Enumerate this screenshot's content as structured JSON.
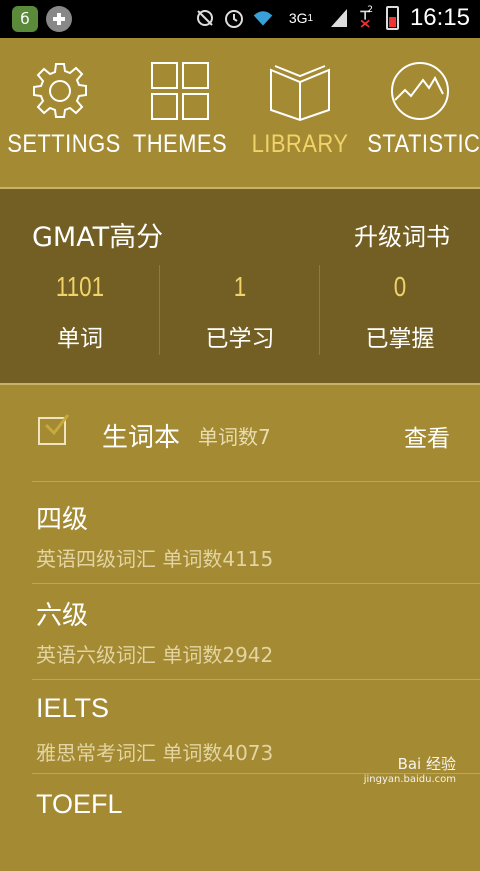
{
  "status_bar": {
    "time": "16:15",
    "network": "3G",
    "sim1": "1",
    "sim2": "2",
    "icons": [
      "app-icon",
      "add-icon",
      "sync-icon",
      "alarm-icon",
      "wifi-icon",
      "signal-icon",
      "battery-icon"
    ]
  },
  "nav": {
    "items": [
      {
        "label": "SETTINGS",
        "icon": "gear-icon"
      },
      {
        "label": "THEMES",
        "icon": "grid-icon"
      },
      {
        "label": "LIBRARY",
        "icon": "book-icon",
        "active": true
      },
      {
        "label": "STATISTICS",
        "icon": "chart-icon"
      }
    ]
  },
  "book": {
    "title": "GMAT高分",
    "upgrade_label": "升级词书",
    "stats": [
      {
        "value": "1101",
        "label": "单词"
      },
      {
        "value": "1",
        "label": "已学习"
      },
      {
        "value": "0",
        "label": "已掌握"
      }
    ]
  },
  "vocab_book": {
    "title": "生词本",
    "count": "单词数7",
    "view_label": "查看",
    "checked": true
  },
  "list": [
    {
      "title": "四级",
      "subtitle": "英语四级词汇  单词数4115"
    },
    {
      "title": "六级",
      "subtitle": "英语六级词汇  单词数2942"
    },
    {
      "title": "IELTS",
      "subtitle": "雅思常考词汇  单词数4073"
    },
    {
      "title": "TOEFL",
      "subtitle": ""
    }
  ],
  "watermark": {
    "text": "Bai 经验",
    "sub": "jingyan.baidu.com"
  },
  "colors": {
    "background": "#A38A33",
    "panel": "#735F23",
    "accent": "#F0D36A",
    "status_bar": "#000000"
  }
}
